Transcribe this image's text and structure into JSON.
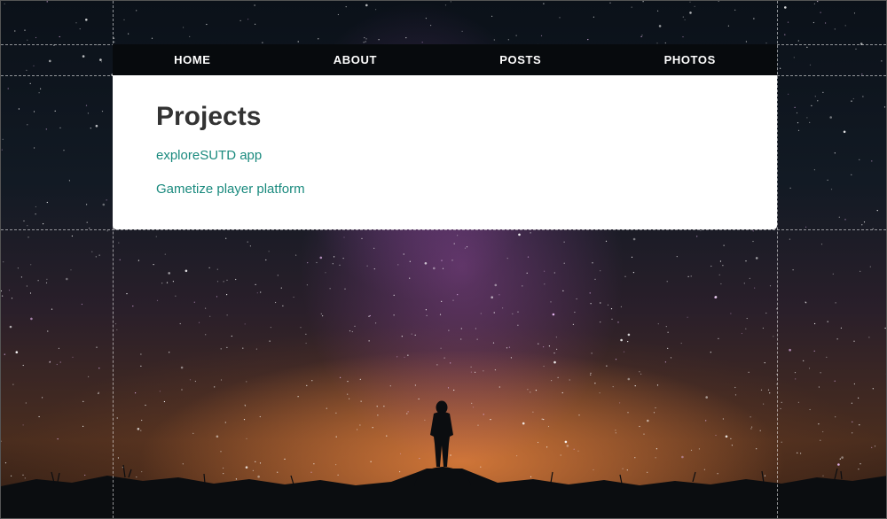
{
  "nav": {
    "items": [
      {
        "label": "HOME"
      },
      {
        "label": "ABOUT"
      },
      {
        "label": "POSTS"
      },
      {
        "label": "PHOTOS"
      }
    ]
  },
  "main": {
    "title": "Projects",
    "projects": [
      {
        "label": "exploreSUTD app"
      },
      {
        "label": "Gametize player platform"
      }
    ]
  },
  "colors": {
    "link": "#1a8a7e",
    "title": "#333333",
    "nav_bg": "#070a0d",
    "nav_text": "#ffffff"
  },
  "background": {
    "image": "starry-night-sky-with-person-silhouette"
  }
}
